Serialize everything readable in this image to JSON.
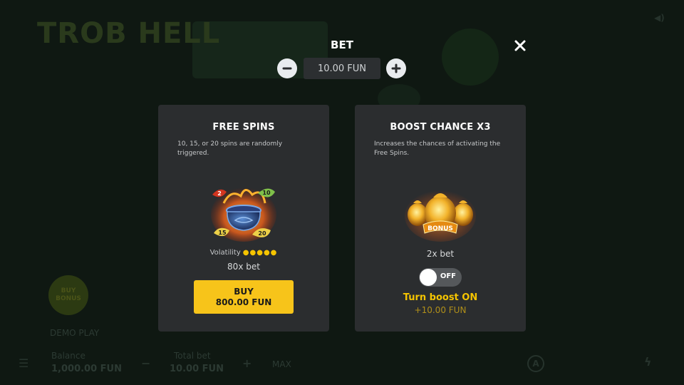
{
  "background": {
    "logo_text": "TROB HELL",
    "buy_bonus_label": "BUY BONUS",
    "mode_label": "DEMO PLAY",
    "balance_label": "Balance",
    "balance_value": "1,000.00 FUN",
    "total_bet_label": "Total bet",
    "total_bet_value": "10.00 FUN",
    "max_label": "MAX",
    "auto_label": "A"
  },
  "header": {
    "title": "BET",
    "bet_value": "10.00 FUN",
    "close_icon": "close-icon",
    "minus_icon": "minus-icon",
    "plus_icon": "plus-icon"
  },
  "free_spins": {
    "title": "FREE SPINS",
    "description": "10, 15, or 20 spins are randomly triggered.",
    "art_icon": "cauldron-icon",
    "leaf_numbers": [
      "2",
      "10",
      "15",
      "20"
    ],
    "volatility_label": "Volatility",
    "volatility_level": 5,
    "volatility_max": 5,
    "volatility_dots": "●●●●●",
    "cost_multiplier": "80x bet",
    "buy_label": "BUY",
    "buy_price": "800.00 FUN"
  },
  "boost": {
    "title": "BOOST CHANCE X3",
    "description": "Increases the chances of activating the Free Spins.",
    "art_icon": "money-bags-icon",
    "art_label": "BONUS",
    "cost_multiplier": "2x bet",
    "toggle_state": "OFF",
    "toggle_on": false,
    "turn_on_label": "Turn boost ON",
    "turn_on_cost": "+10.00 FUN"
  },
  "colors": {
    "accent_yellow": "#f7c41a",
    "card_bg": "#2b2d2f",
    "overlay_bg": "#0f1812"
  }
}
